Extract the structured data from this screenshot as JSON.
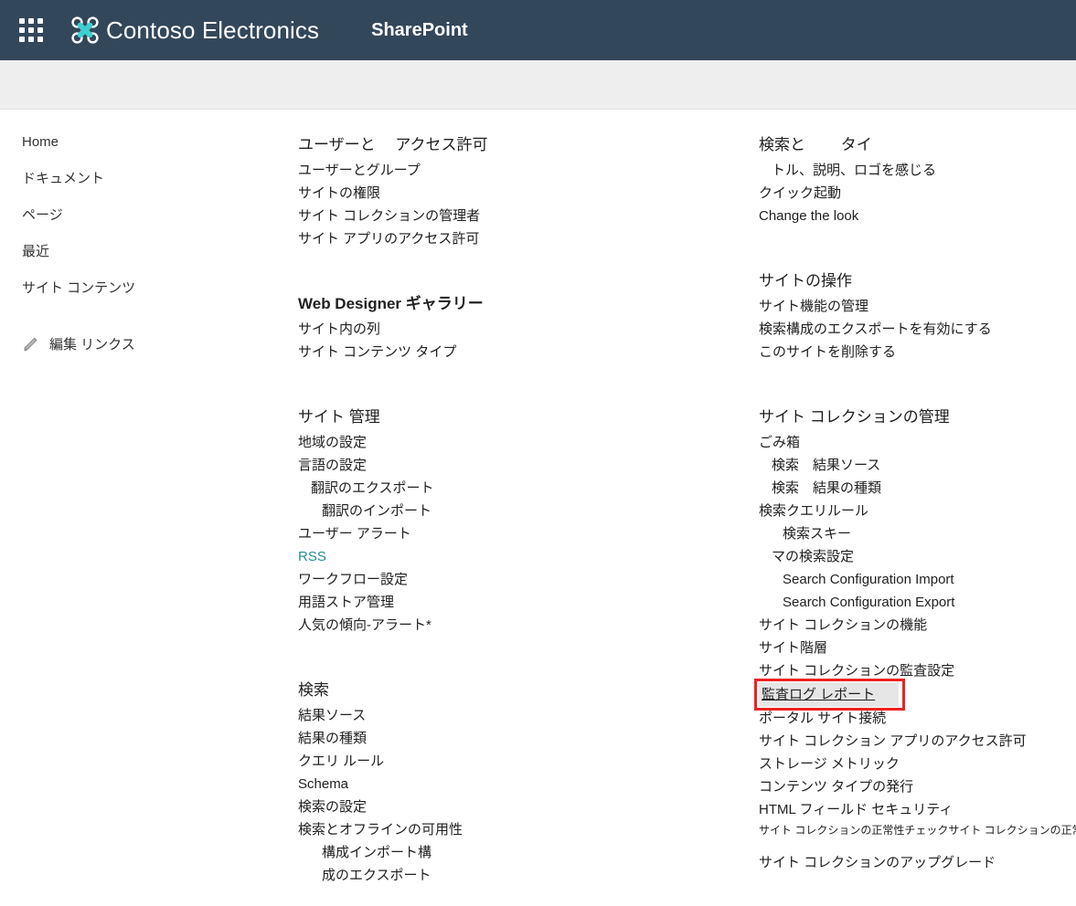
{
  "suite": {
    "waffle_label": "app-launcher",
    "brand_name": "Contoso Electronics",
    "app_name": "SharePoint"
  },
  "leftnav": {
    "items": [
      {
        "label": "Home"
      },
      {
        "label": "ドキュメント"
      },
      {
        "label": "ページ"
      },
      {
        "label": "最近"
      },
      {
        "label": "サイト コンテンツ"
      }
    ],
    "edit_links_label": "編集 リンクス"
  },
  "columns": {
    "middle": [
      {
        "heading": "ユーザーと 　アクセス許可",
        "heading_bold": false,
        "items": [
          {
            "label": "ユーザーとグループ",
            "indent": 0,
            "style": "normal"
          },
          {
            "label": "サイトの権限",
            "indent": 0,
            "style": "normal"
          },
          {
            "label": "サイト コレクションの管理者",
            "indent": 0,
            "style": "normal"
          },
          {
            "label": "サイト アプリのアクセス許可",
            "indent": 0,
            "style": "normal"
          }
        ]
      },
      {
        "heading": "Web Designer ギャラリー",
        "heading_bold": true,
        "items": [
          {
            "label": "サイト内の列",
            "indent": 0,
            "style": "normal"
          },
          {
            "label": "サイト コンテンツ タイプ",
            "indent": 0,
            "style": "normal"
          }
        ]
      },
      {
        "heading": "サイト 管理",
        "heading_bold": false,
        "items": [
          {
            "label": "地域の設定",
            "indent": 0,
            "style": "normal"
          },
          {
            "label": "言語の設定",
            "indent": 0,
            "style": "normal"
          },
          {
            "label": "翻訳のエクスポート",
            "indent": 1,
            "style": "normal"
          },
          {
            "label": "翻訳のインポート",
            "indent": 2,
            "style": "normal"
          },
          {
            "label": "ユーザー アラート",
            "indent": 0,
            "style": "normal"
          },
          {
            "label": "RSS",
            "indent": 0,
            "style": "accent"
          },
          {
            "label": "ワークフロー設定",
            "indent": 0,
            "style": "normal"
          },
          {
            "label": "用語ストア管理",
            "indent": 0,
            "style": "normal"
          },
          {
            "label": "人気の傾向-アラート*",
            "indent": 0,
            "style": "normal"
          }
        ]
      },
      {
        "heading": "検索",
        "heading_bold": false,
        "items": [
          {
            "label": "結果ソース",
            "indent": 0,
            "style": "normal"
          },
          {
            "label": "結果の種類",
            "indent": 0,
            "style": "normal"
          },
          {
            "label": "クエリ ルール",
            "indent": 0,
            "style": "normal"
          },
          {
            "label": "Schema",
            "indent": 0,
            "style": "normal"
          },
          {
            "label": "検索の設定",
            "indent": 0,
            "style": "normal"
          },
          {
            "label": "検索とオフラインの可用性",
            "indent": 0,
            "style": "normal"
          },
          {
            "label": "構成インポート構",
            "indent": 2,
            "style": "normal"
          },
          {
            "label": "成のエクスポート",
            "indent": 2,
            "style": "normal"
          }
        ]
      }
    ],
    "right": [
      {
        "heading": "検索と 　　タイ",
        "heading_bold": false,
        "items": [
          {
            "label": "トル、説明、ロゴを感じる",
            "indent": 1,
            "style": "normal"
          },
          {
            "label": "クイック起動",
            "indent": 0,
            "style": "normal"
          },
          {
            "label": "Change the look",
            "indent": 0,
            "style": "normal"
          }
        ]
      },
      {
        "heading": "サイトの操作",
        "heading_bold": false,
        "items": [
          {
            "label": "サイト機能の管理",
            "indent": 0,
            "style": "normal"
          },
          {
            "label": "検索構成のエクスポートを有効にする",
            "indent": 0,
            "style": "normal"
          },
          {
            "label": "このサイトを削除する",
            "indent": 0,
            "style": "normal"
          }
        ]
      },
      {
        "heading": "サイト コレクションの管理",
        "heading_bold": false,
        "items": [
          {
            "label": "ごみ箱",
            "indent": 0,
            "style": "normal"
          },
          {
            "label": "検索　結果ソース",
            "indent": 1,
            "style": "normal"
          },
          {
            "label": "検索　結果の種類",
            "indent": 1,
            "style": "normal"
          },
          {
            "label": "検索クエリルール",
            "indent": 0,
            "style": "normal"
          },
          {
            "label": "検索スキー",
            "indent": 2,
            "style": "normal"
          },
          {
            "label": "マの検索設定",
            "indent": 1,
            "style": "normal"
          },
          {
            "label": "Search Configuration Import",
            "indent": 2,
            "style": "normal"
          },
          {
            "label": "Search Configuration Export",
            "indent": 2,
            "style": "normal"
          },
          {
            "label": "サイト コレクションの機能",
            "indent": 0,
            "style": "normal"
          },
          {
            "label": "サイト階層",
            "indent": 0,
            "style": "normal"
          },
          {
            "label": "サイト コレクションの監査設定",
            "indent": 0,
            "style": "normal"
          },
          {
            "label": "監査ログ レポート",
            "indent": 0,
            "style": "callout"
          },
          {
            "label": "ポータル サイト接続",
            "indent": 0,
            "style": "normal"
          },
          {
            "label": "サイト コレクション アプリのアクセス許可",
            "indent": 0,
            "style": "normal"
          },
          {
            "label": "ストレージ メトリック",
            "indent": 0,
            "style": "normal"
          },
          {
            "label": "コンテンツ タイプの発行",
            "indent": 0,
            "style": "normal"
          },
          {
            "label": "HTML フィールド セキュリティ",
            "indent": 0,
            "style": "normal"
          },
          {
            "label": "サイト コレクションの正常性チェックサイト コレクションの正常性チェック",
            "indent": 0,
            "style": "small"
          },
          {
            "label": "サイト コレクションのアップグレード",
            "indent": 0,
            "style": "normal"
          }
        ]
      }
    ]
  },
  "colors": {
    "suite_bar": "#33475b",
    "sub_band": "#eeeeee",
    "accent_link": "#2a8a9e",
    "callout_border": "#ee2222",
    "callout_fill": "#e6e6e6",
    "text": "#212121"
  }
}
